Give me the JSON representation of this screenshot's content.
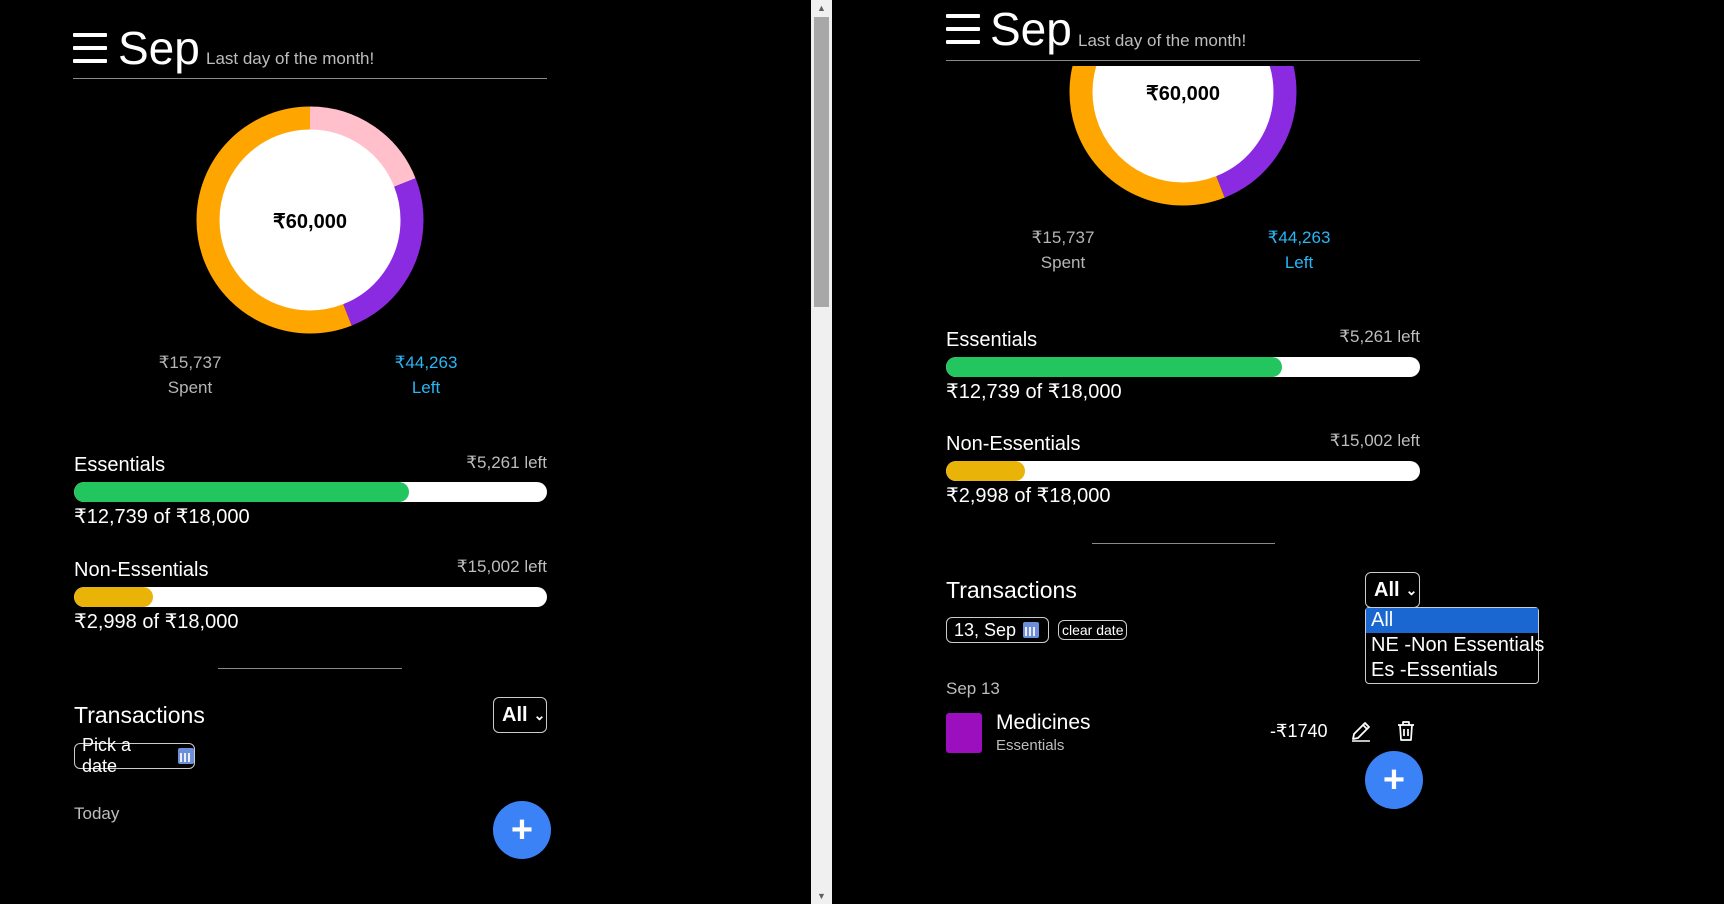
{
  "header": {
    "month": "Sep",
    "subtitle": "Last day of the month!"
  },
  "budget": {
    "total": "₹60,000",
    "spent_value": "₹15,737",
    "spent_label": "Spent",
    "left_value": "₹44,263",
    "left_label": "Left"
  },
  "donut": {
    "segments": [
      {
        "name": "Left pink",
        "fraction": 0.19,
        "color": "#ffc0cb"
      },
      {
        "name": "Essentials",
        "fraction": 0.25,
        "color": "#8a2be2"
      },
      {
        "name": "Orange",
        "fraction": 0.56,
        "color": "#ffa500"
      }
    ]
  },
  "categories": [
    {
      "name": "Essentials",
      "left": "₹5,261 left",
      "amount": "₹12,739 of ₹18,000",
      "fraction": 0.708,
      "color": "#22c55e"
    },
    {
      "name": "Non-Essentials",
      "left": "₹15,002 left",
      "amount": "₹2,998 of ₹18,000",
      "fraction": 0.167,
      "color": "#eab308"
    }
  ],
  "transactions": {
    "title": "Transactions",
    "filter_value": "All",
    "filter_options": [
      "All",
      "NE -Non Essentials",
      "Es -Essentials"
    ],
    "pick_date": "Pick a date",
    "selected_date": "13, Sep",
    "clear_date": "clear date",
    "today_label": "Today",
    "day_label": "Sep 13",
    "items": [
      {
        "name": "Medicines",
        "category": "Essentials",
        "amount": "-₹1740",
        "color": "#9b0fbf"
      }
    ]
  },
  "fab_label": "+"
}
